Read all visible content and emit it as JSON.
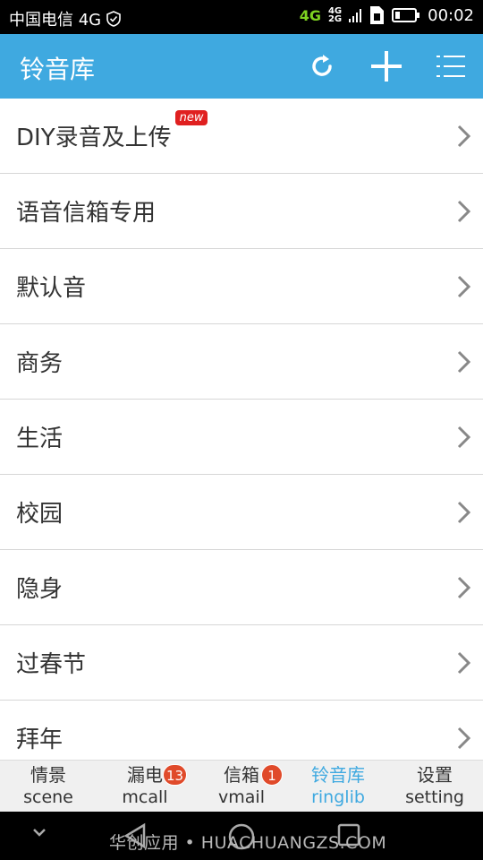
{
  "status_bar": {
    "carrier": "中国电信 4G",
    "network_top": "4G",
    "network_small_top": "4G",
    "network_small_bottom": "2G",
    "time": "00:02"
  },
  "header": {
    "title": "铃音库"
  },
  "list": {
    "items": [
      {
        "label": "DIY录音及上传",
        "badge": "new"
      },
      {
        "label": "语音信箱专用"
      },
      {
        "label": "默认音"
      },
      {
        "label": "商务"
      },
      {
        "label": "生活"
      },
      {
        "label": "校园"
      },
      {
        "label": "隐身"
      },
      {
        "label": "过春节"
      },
      {
        "label": "拜年"
      }
    ]
  },
  "tabs": [
    {
      "zh": "情景",
      "en": "scene"
    },
    {
      "zh": "漏电",
      "en": "mcall",
      "badge": "13"
    },
    {
      "zh": "信箱",
      "en": "vmail",
      "badge": "1"
    },
    {
      "zh": "铃音库",
      "en": "ringlib",
      "active": true
    },
    {
      "zh": "设置",
      "en": "setting"
    }
  ],
  "watermark": "华创应用 • HUACHUANGZS.COM",
  "colors": {
    "accent": "#3fa9e0",
    "badge": "#e04a2a",
    "new_badge": "#e02020"
  }
}
